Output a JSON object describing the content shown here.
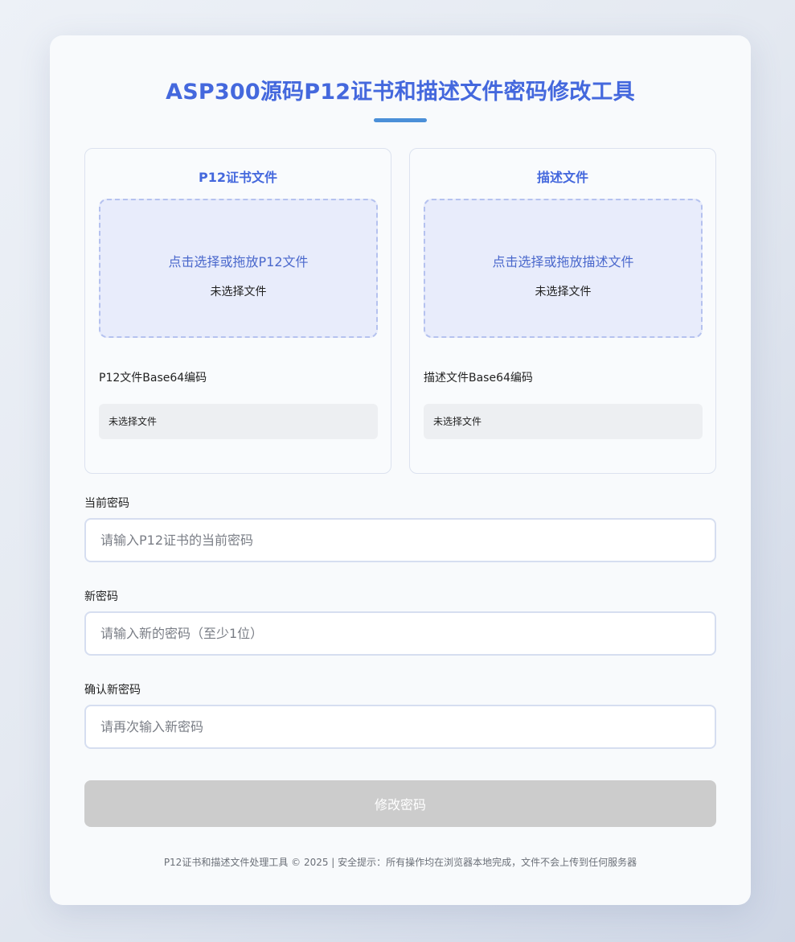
{
  "title": "ASP300源码P12证书和描述文件密码修改工具",
  "colors": {
    "accent": "#4468dd",
    "title_bar": "#4b8fd8",
    "dropzone_bg": "#e8ecfb",
    "button_disabled": "#cccccc"
  },
  "panels": {
    "p12": {
      "title": "P12证书文件",
      "drop_text": "点击选择或拖放P12文件",
      "file_status": "未选择文件",
      "b64_label": "P12文件Base64编码",
      "b64_value": "未选择文件"
    },
    "profile": {
      "title": "描述文件",
      "drop_text": "点击选择或拖放描述文件",
      "file_status": "未选择文件",
      "b64_label": "描述文件Base64编码",
      "b64_value": "未选择文件"
    }
  },
  "form": {
    "current": {
      "label": "当前密码",
      "placeholder": "请输入P12证书的当前密码",
      "value": ""
    },
    "new": {
      "label": "新密码",
      "placeholder": "请输入新的密码（至少1位）",
      "value": ""
    },
    "confirm": {
      "label": "确认新密码",
      "placeholder": "请再次输入新密码",
      "value": ""
    }
  },
  "submit_label": "修改密码",
  "footer": "P12证书和描述文件处理工具 © 2025 | 安全提示：所有操作均在浏览器本地完成，文件不会上传到任何服务器"
}
